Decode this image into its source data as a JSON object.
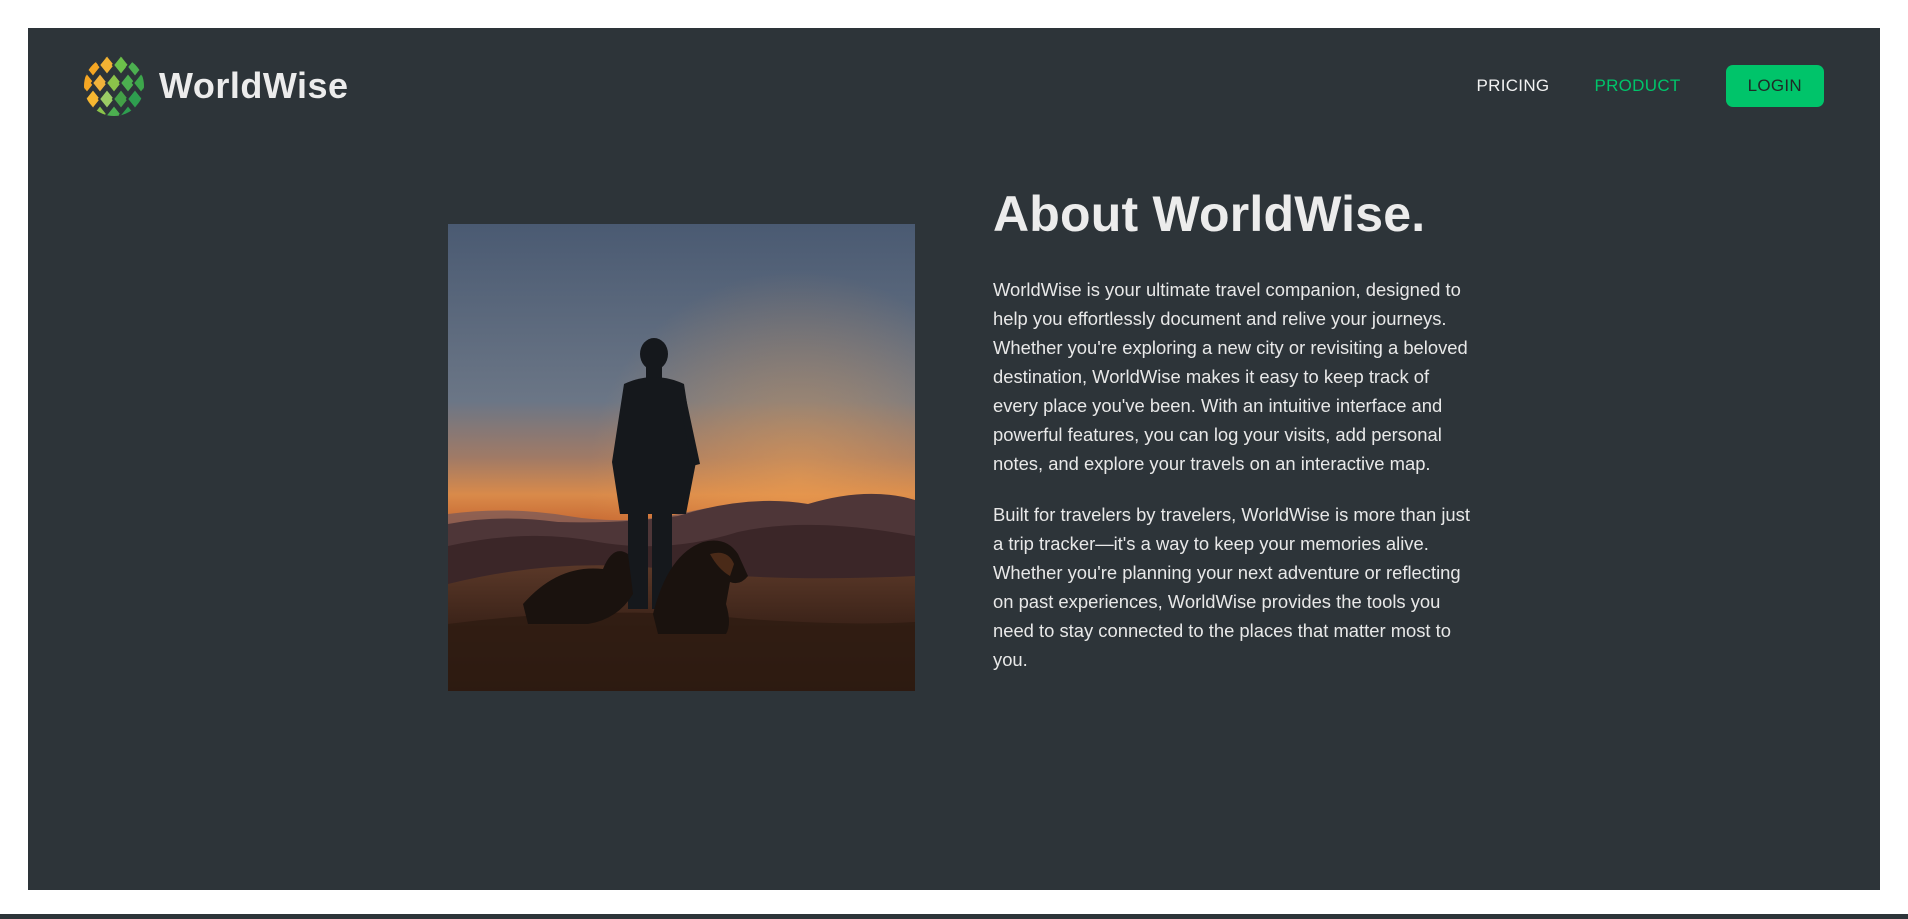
{
  "header": {
    "brand_name": "WorldWise",
    "nav": {
      "pricing_label": "PRICING",
      "product_label": "PRODUCT",
      "login_label": "LOGIN"
    }
  },
  "main": {
    "title": "About WorldWise.",
    "paragraphs": [
      "WorldWise is your ultimate travel companion, designed to help you effortlessly document and relive your journeys. Whether you're exploring a new city or revisiting a beloved destination, WorldWise makes it easy to keep track of every place you've been. With an intuitive interface and powerful features, you can log your visits, add personal notes, and explore your travels on an interactive map.",
      "Built for travelers by travelers, WorldWise is more than just a trip tracker—it's a way to keep your memories alive. Whether you're planning your next adventure or reflecting on past experiences, WorldWise provides the tools you need to stay connected to the places that matter most to you."
    ]
  },
  "colors": {
    "background": "#2d3439",
    "accent": "#00c46a",
    "text": "#ececec"
  },
  "icons": {
    "logo": "globe-logo-icon"
  }
}
